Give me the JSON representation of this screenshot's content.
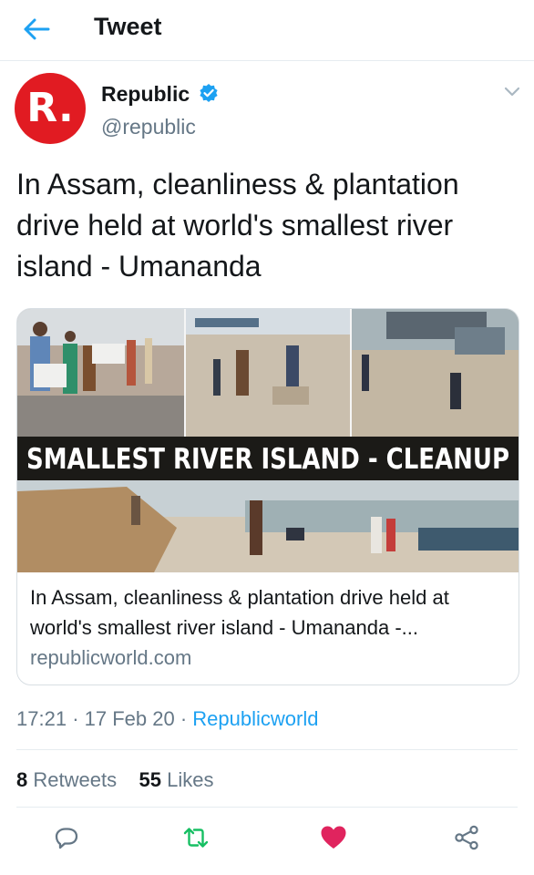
{
  "header": {
    "title": "Tweet"
  },
  "tweet": {
    "author": {
      "name": "Republic",
      "handle": "@republic",
      "avatar_letter": "R."
    },
    "text": "In Assam, cleanliness & plantation drive held at world's smallest river island - Umananda",
    "card": {
      "banner_text": "SMALLEST RIVER ISLAND - CLEANUP",
      "title": "In Assam, cleanliness & plantation drive held at world's smallest river island - Umananda -...",
      "domain": "republicworld.com"
    },
    "time": "17:21",
    "date": "17 Feb 20",
    "source": "Republicworld",
    "retweets_count": "8",
    "retweets_label": "Retweets",
    "likes_count": "55",
    "likes_label": "Likes"
  },
  "actions": {
    "reply_icon": "reply-icon",
    "retweet_icon": "retweet-icon",
    "like_icon": "heart-icon",
    "share_icon": "share-icon"
  },
  "colors": {
    "accent": "#1da1f2",
    "brand": "#e11b22",
    "retweet": "#17bf63",
    "like": "#e0245e"
  }
}
